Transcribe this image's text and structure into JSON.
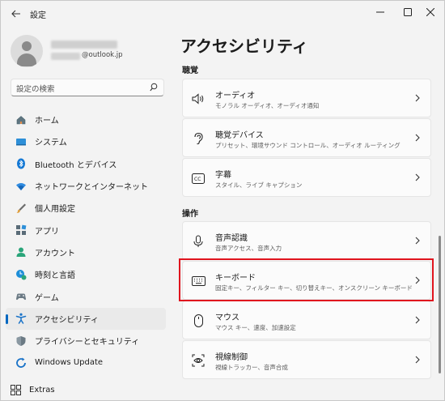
{
  "window": {
    "title": "設定",
    "back_icon": "arrow-left-icon",
    "controls": [
      "minimize",
      "maximize",
      "close"
    ]
  },
  "profile": {
    "email_suffix": "@outlook.jp"
  },
  "search": {
    "placeholder": "設定の検索"
  },
  "sidebar": {
    "items": [
      {
        "label": "ホーム",
        "icon": "home-icon"
      },
      {
        "label": "システム",
        "icon": "system-icon"
      },
      {
        "label": "Bluetooth とデバイス",
        "icon": "bluetooth-icon"
      },
      {
        "label": "ネットワークとインターネット",
        "icon": "wifi-icon"
      },
      {
        "label": "個人用設定",
        "icon": "brush-icon"
      },
      {
        "label": "アプリ",
        "icon": "apps-icon"
      },
      {
        "label": "アカウント",
        "icon": "account-icon"
      },
      {
        "label": "時刻と言語",
        "icon": "time-language-icon"
      },
      {
        "label": "ゲーム",
        "icon": "gaming-icon"
      },
      {
        "label": "アクセシビリティ",
        "icon": "accessibility-icon",
        "active": true
      },
      {
        "label": "プライバシーとセキュリティ",
        "icon": "shield-icon"
      },
      {
        "label": "Windows Update",
        "icon": "update-icon"
      }
    ],
    "extras": {
      "label": "Extras",
      "icon": "extras-icon"
    }
  },
  "main": {
    "title": "アクセシビリティ",
    "sections": [
      {
        "label": "聴覚",
        "cards": [
          {
            "title": "オーディオ",
            "subtitle": "モノラル オーディオ、オーディオ通知",
            "icon": "speaker-icon"
          },
          {
            "title": "聴覚デバイス",
            "subtitle": "プリセット、環境サウンド コントロール、オーディオ ルーティング",
            "icon": "ear-icon"
          },
          {
            "title": "字幕",
            "subtitle": "スタイル、ライブ キャプション",
            "icon": "captions-icon"
          }
        ]
      },
      {
        "label": "操作",
        "cards": [
          {
            "title": "音声認識",
            "subtitle": "音声アクセス、音声入力",
            "icon": "microphone-icon"
          },
          {
            "title": "キーボード",
            "subtitle": "固定キー、フィルター キー、切り替えキー、オンスクリーン キーボード",
            "icon": "keyboard-icon",
            "highlighted": true
          },
          {
            "title": "マウス",
            "subtitle": "マウス キー、速度、加速設定",
            "icon": "mouse-icon"
          },
          {
            "title": "視線制御",
            "subtitle": "視線トラッカー、音声合成",
            "icon": "eye-control-icon"
          }
        ]
      }
    ]
  },
  "colors": {
    "accent": "#0067c0",
    "highlight_border": "#e0141e",
    "background": "#f3f3f3",
    "card": "#fbfbfb"
  }
}
